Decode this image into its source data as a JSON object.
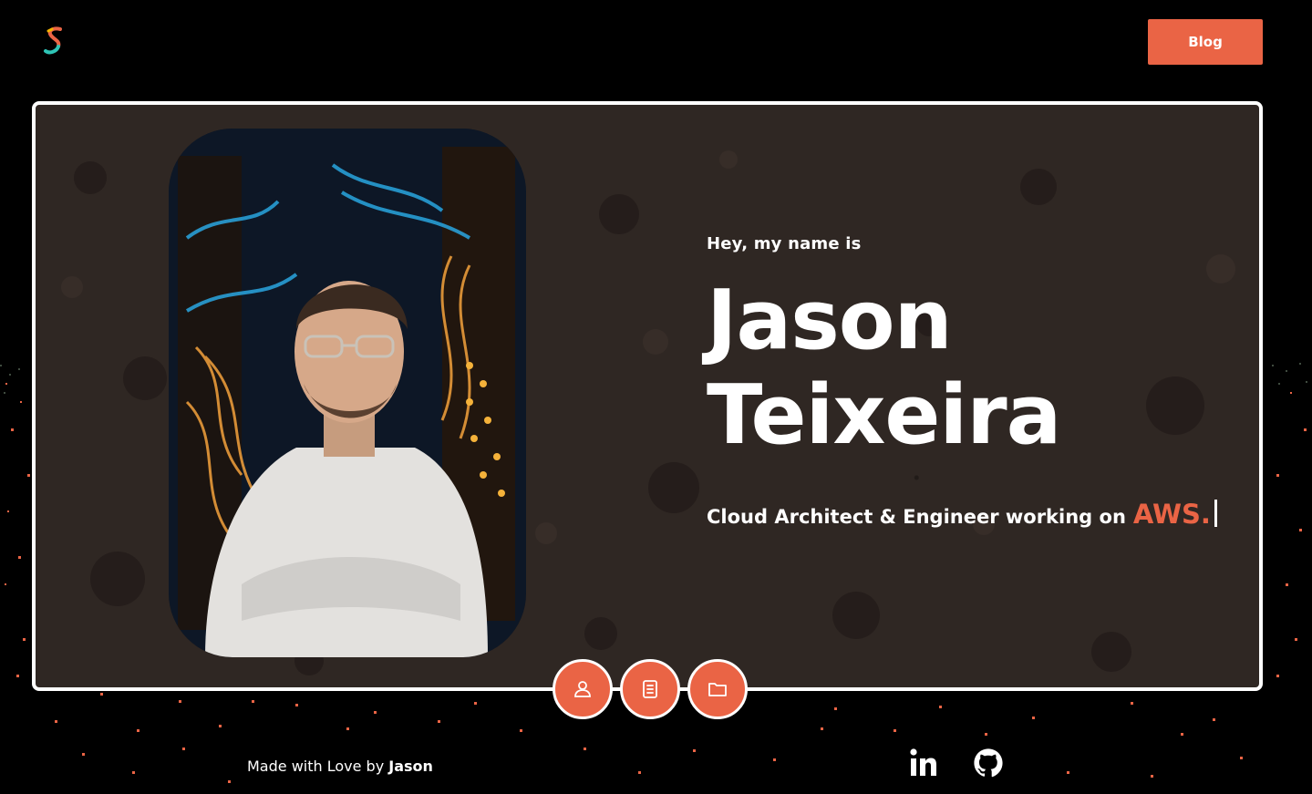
{
  "header": {
    "logo_icon": "s-logo-icon",
    "blog_label": "Blog"
  },
  "hero": {
    "intro": "Hey, my name is",
    "first_name": "Jason",
    "last_name": "Teixeira",
    "tagline": "Cloud Architect & Engineer working on",
    "highlight": "AWS."
  },
  "nav": {
    "items": [
      {
        "icon": "user-icon"
      },
      {
        "icon": "document-icon"
      },
      {
        "icon": "folder-icon"
      }
    ]
  },
  "footer": {
    "credit_prefix": "Made with Love by",
    "credit_name": "Jason",
    "social": [
      {
        "icon": "linkedin-icon"
      },
      {
        "icon": "github-icon"
      }
    ]
  },
  "colors": {
    "accent": "#ea6445",
    "background": "#000000",
    "card": "#2f2723"
  }
}
